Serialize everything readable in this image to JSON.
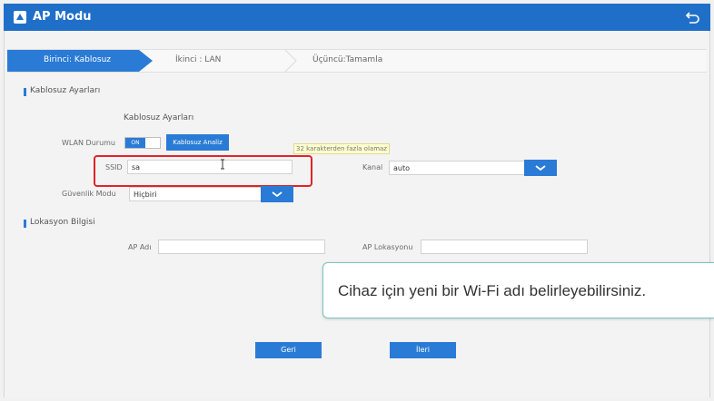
{
  "window": {
    "title": "AP Modu",
    "back_icon": "undo-arrow-icon",
    "accent": "#2a7bd6",
    "titlebar_color": "#1f6fc9"
  },
  "steps": [
    {
      "label": "Birinci: Kablosuz",
      "active": true
    },
    {
      "label": "İkinci : LAN",
      "active": false
    },
    {
      "label": "Üçüncü:Tamamla",
      "active": false
    }
  ],
  "wireless": {
    "section_title": "Kablosuz Ayarları",
    "subtitle": "Kablosuz Ayarları",
    "wlan_label": "WLAN Durumu",
    "wlan_toggle": "ON",
    "analyze_button": "Kablosuz Analiz",
    "ssid_label": "SSID",
    "ssid_value": "sa",
    "ssid_hint": "32 karakterden fazla olamaz",
    "channel_label": "Kanal",
    "channel_value": "auto",
    "security_label": "Güvenlik Modu",
    "security_value": "Hiçbiri"
  },
  "location": {
    "section_title": "Lokasyon Bilgisi",
    "ap_name_label": "AP Adı",
    "ap_name_value": "",
    "ap_location_label": "AP Lokasyonu",
    "ap_location_value": ""
  },
  "buttons": {
    "back": "Geri",
    "next": "İleri"
  },
  "tooltip": "Cihaz için yeni bir Wi-Fi adı belirleyebilirsiniz."
}
